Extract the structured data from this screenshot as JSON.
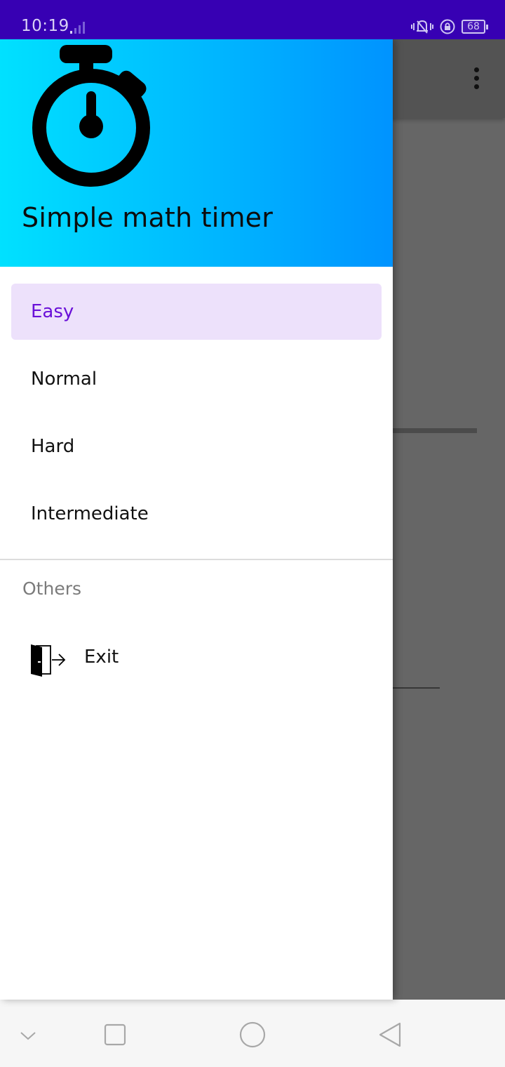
{
  "status_bar": {
    "time": "10:19",
    "battery": "68"
  },
  "drawer": {
    "header": {
      "app_title": "Simple math timer",
      "logo_icon": "stopwatch-icon",
      "gradient_start": "#00e1ff",
      "gradient_end": "#0093ff"
    },
    "menu_items": [
      {
        "label": "Easy",
        "selected": true
      },
      {
        "label": "Normal",
        "selected": false
      },
      {
        "label": "Hard",
        "selected": false
      },
      {
        "label": "Intermediate",
        "selected": false
      }
    ],
    "section": {
      "title": "Others",
      "items": [
        {
          "label": "Exit",
          "icon": "exit-door-icon"
        }
      ]
    }
  },
  "colors": {
    "status_bar": "#3700b3",
    "selected_background": "#ede1fb",
    "selected_text": "#6a10d8"
  },
  "nav_bar": {
    "buttons": [
      "chevron-down-icon",
      "recents-square-icon",
      "home-circle-icon",
      "back-triangle-icon"
    ]
  }
}
